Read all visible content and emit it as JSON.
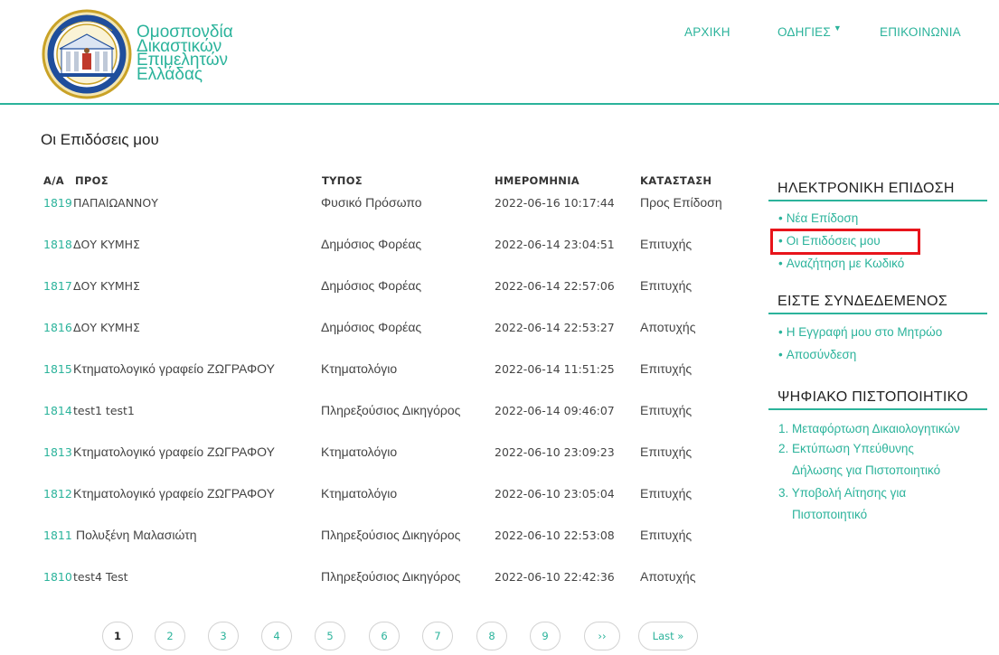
{
  "brand": {
    "lines": [
      "Ομοσπονδία",
      "Δικαστικών",
      "Επιμελητών",
      "Ελλάδας"
    ]
  },
  "nav": {
    "home": "ΑΡΧΙΚΗ",
    "guides": "ΟΔΗΓΙΕΣ",
    "contact": "ΕΠΙΚΟΙΝΩΝΙΑ"
  },
  "page_title": "Οι Επιδόσεις μου",
  "table": {
    "headers": {
      "id": "Α/Α",
      "to": "ΠΡΟΣ",
      "type": "ΤΥΠΟΣ",
      "date": "ΗΜΕΡΟΜΗΝΙΑ",
      "status": "ΚΑΤΑΣΤΑΣΗ"
    },
    "rows": [
      {
        "id": "1819",
        "to": "ΠΑΠΑΙΩΑΝΝΟΥ",
        "type": "Φυσικό Πρόσωπο",
        "date": "2022-06-16 10:17:44",
        "status": "Προς Επίδοση"
      },
      {
        "id": "1818",
        "to": "ΔΟΥ ΚΥΜΗΣ",
        "type": "Δημόσιος Φορέας",
        "date": "2022-06-14 23:04:51",
        "status": "Επιτυχής"
      },
      {
        "id": "1817",
        "to": "ΔΟΥ ΚΥΜΗΣ",
        "type": "Δημόσιος Φορέας",
        "date": "2022-06-14 22:57:06",
        "status": "Επιτυχής"
      },
      {
        "id": "1816",
        "to": "ΔΟΥ ΚΥΜΗΣ",
        "type": "Δημόσιος Φορέας",
        "date": "2022-06-14 22:53:27",
        "status": "Αποτυχής"
      },
      {
        "id": "1815",
        "to": "Κτηματολογικό γραφείο ΖΩΓΡΑΦΟΥ",
        "type": "Κτηματολόγιο",
        "date": "2022-06-14 11:51:25",
        "status": "Επιτυχής"
      },
      {
        "id": "1814",
        "to": "test1 test1",
        "type": "Πληρεξούσιος Δικηγόρος",
        "date": "2022-06-14 09:46:07",
        "status": "Επιτυχής"
      },
      {
        "id": "1813",
        "to": "Κτηματολογικό γραφείο ΖΩΓΡΑΦΟΥ",
        "type": "Κτηματολόγιο",
        "date": "2022-06-10 23:09:23",
        "status": "Επιτυχής"
      },
      {
        "id": "1812",
        "to": "Κτηματολογικό γραφείο ΖΩΓΡΑΦΟΥ",
        "type": "Κτηματολόγιο",
        "date": "2022-06-10 23:05:04",
        "status": "Επιτυχής"
      },
      {
        "id": "1811",
        "to": "Πολυξένη Μαλασιώτη",
        "type": "Πληρεξούσιος Δικηγόρος",
        "date": "2022-06-10 22:53:08",
        "status": "Επιτυχής"
      },
      {
        "id": "1810",
        "to": "test4 Test",
        "type": "Πληρεξούσιος Δικηγόρος",
        "date": "2022-06-10 22:42:36",
        "status": "Αποτυχής"
      }
    ]
  },
  "sidebar": {
    "e_service": {
      "title": "ΗΛΕΚΤΡΟΝΙΚΗ ΕΠΙΔΟΣΗ",
      "links": [
        "Νέα Επίδοση",
        "Οι Επιδόσεις μου",
        "Αναζήτηση με Κωδικό"
      ]
    },
    "logged_in": {
      "title": "ΕΙΣΤΕ ΣΥΝΔΕΔΕΜΕΝΟΣ",
      "links": [
        "Η Εγγραφή μου στο Μητρώο",
        "Αποσύνδεση"
      ]
    },
    "certificate": {
      "title": "ΨΗΦΙΑΚΟ ΠΙΣΤΟΠΟΙΗΤΙΚΟ",
      "steps": [
        {
          "num": "1.",
          "line1": "Μεταφόρτωση Δικαιολογητικών",
          "line2": ""
        },
        {
          "num": "2.",
          "line1": "Εκτύπωση Υπεύθυνης",
          "line2": "Δήλωσης για Πιστοποιητικό"
        },
        {
          "num": "3.",
          "line1": "Υποβολή Αίτησης για",
          "line2": "Πιστοποιητικό"
        }
      ]
    }
  },
  "pagination": {
    "pages": [
      "1",
      "2",
      "3",
      "4",
      "5",
      "6",
      "7",
      "8",
      "9"
    ],
    "next": "››",
    "last": "Last »",
    "current": "1"
  },
  "colors": {
    "accent": "#2bb39b",
    "highlight": "#e8141b",
    "logo_gold": "#c9a227",
    "logo_blue": "#1f4e9c"
  }
}
